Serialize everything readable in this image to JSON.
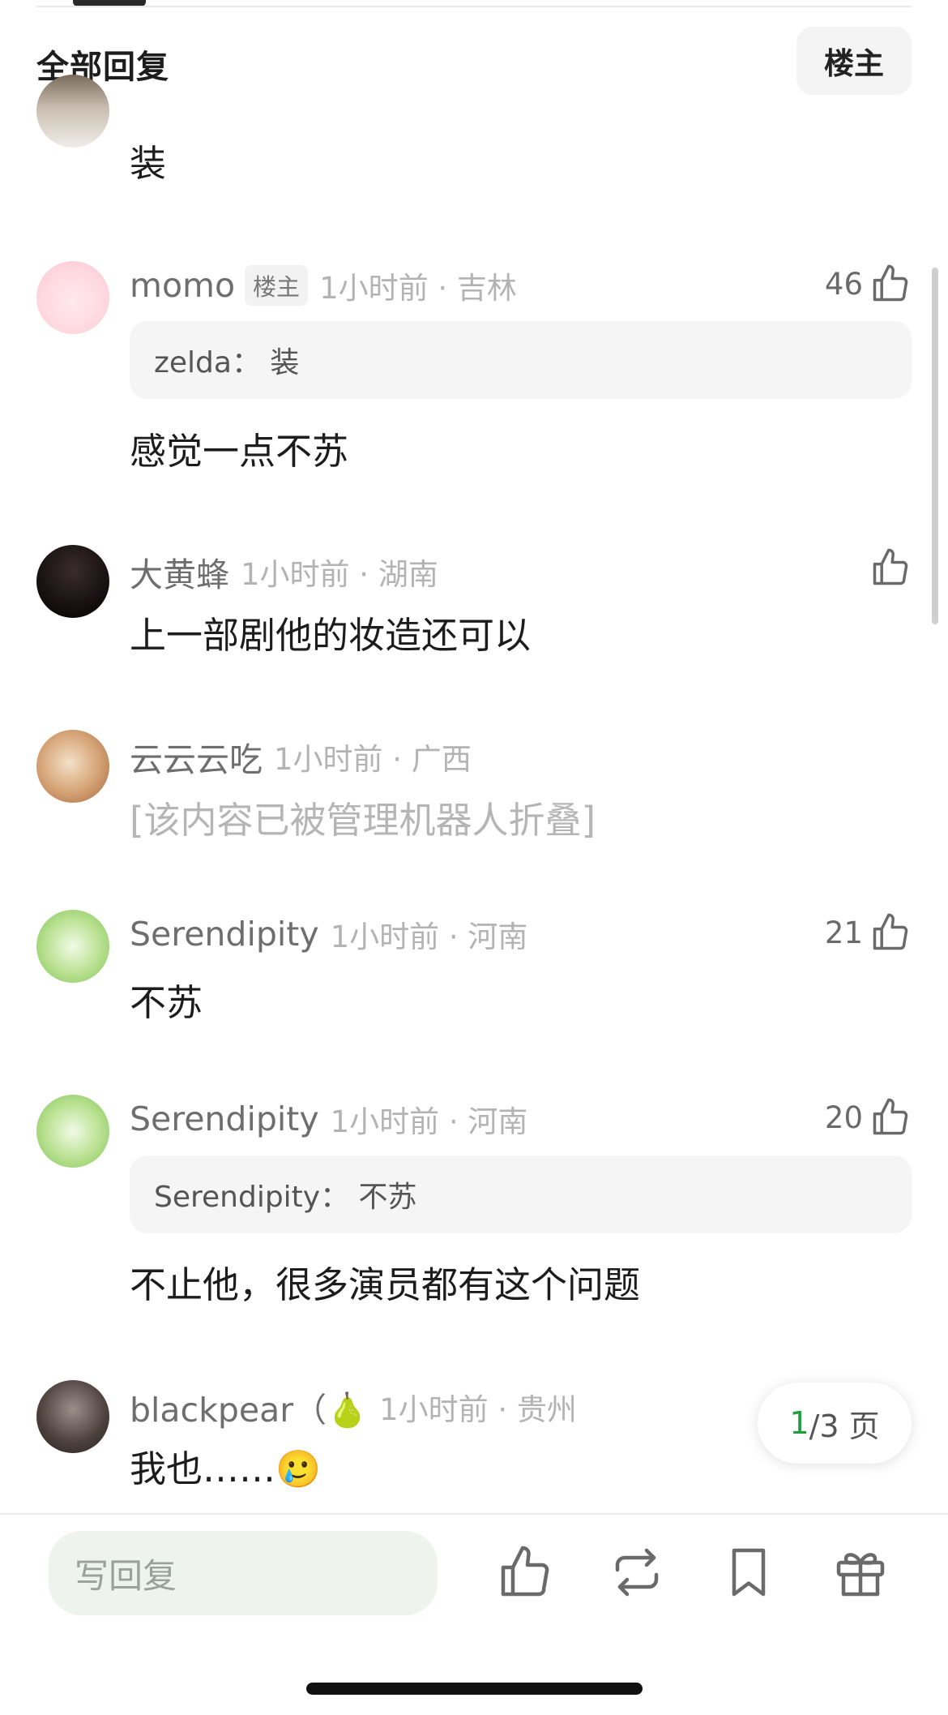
{
  "header": {
    "title": "全部回复",
    "op_filter_label": "楼主"
  },
  "comments": [
    {
      "username": "",
      "meta": "",
      "content": "装"
    },
    {
      "username": "momo",
      "badge": "楼主",
      "meta": "1小时前 · 吉林",
      "likes": "46",
      "quote": "zelda： 装",
      "content": "感觉一点不苏"
    },
    {
      "username": "大黄蜂",
      "meta": "1小时前 · 湖南",
      "likes": "",
      "content": "上一部剧他的妆造还可以"
    },
    {
      "username": "云云云吃",
      "meta": "1小时前 · 广西",
      "content": "[该内容已被管理机器人折叠]"
    },
    {
      "username": "Serendipity",
      "meta": "1小时前 · 河南",
      "likes": "21",
      "content": "不苏"
    },
    {
      "username": "Serendipity",
      "meta": "1小时前 · 河南",
      "likes": "20",
      "quote": "Serendipity： 不苏",
      "content": "不止他，很多演员都有这个问题"
    },
    {
      "username": "blackpear（🍐",
      "meta": "1小时前 · 贵州",
      "content": "我也……🥲"
    }
  ],
  "pagination": {
    "current": "1",
    "rest": "/3 页"
  },
  "bottom_bar": {
    "reply_placeholder": "写回复",
    "icons": [
      "thumbs-up-icon",
      "repost-icon",
      "bookmark-icon",
      "gift-icon"
    ]
  },
  "colors": {
    "accent_green": "#1e9e3e",
    "username_gray": "#6e6e6e",
    "meta_gray": "#b3b3b3"
  }
}
